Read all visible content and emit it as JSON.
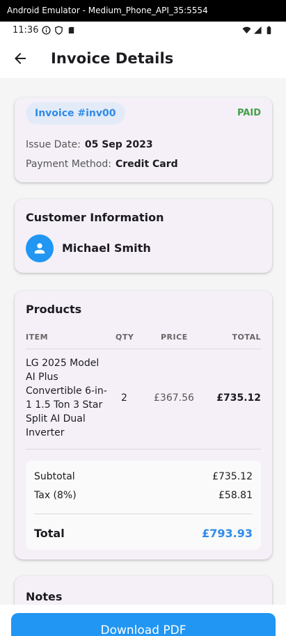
{
  "window": {
    "title": "Android Emulator - Medium_Phone_API_35:5554"
  },
  "status_bar": {
    "time": "11:36"
  },
  "app_bar": {
    "title": "Invoice Details"
  },
  "invoice": {
    "number": "Invoice #inv00",
    "status": "PAID",
    "status_color": "#43a047",
    "issue_date_label": "Issue Date:",
    "issue_date": "05 Sep 2023",
    "payment_method_label": "Payment Method:",
    "payment_method": "Credit Card"
  },
  "customer": {
    "section_title": "Customer Information",
    "name": "Michael Smith"
  },
  "products": {
    "section_title": "Products",
    "columns": [
      "ITEM",
      "QTY",
      "PRICE",
      "TOTAL"
    ],
    "rows": [
      {
        "item": "LG 2025 Model AI Plus Convertible 6-in-1 1.5 Ton 3 Star Split AI Dual Inverter",
        "qty": "2",
        "price": "£367.56",
        "total": "£735.12"
      }
    ]
  },
  "totals": {
    "subtotal_label": "Subtotal",
    "subtotal": "£735.12",
    "tax_label": "Tax (8%)",
    "tax": "£58.81",
    "total_label": "Total",
    "total": "£793.93"
  },
  "notes": {
    "section_title": "Notes"
  },
  "actions": {
    "download_label": "Download PDF"
  },
  "colors": {
    "accent": "#2196f3",
    "paid": "#43a047",
    "card_bg": "#f5f0f8"
  }
}
